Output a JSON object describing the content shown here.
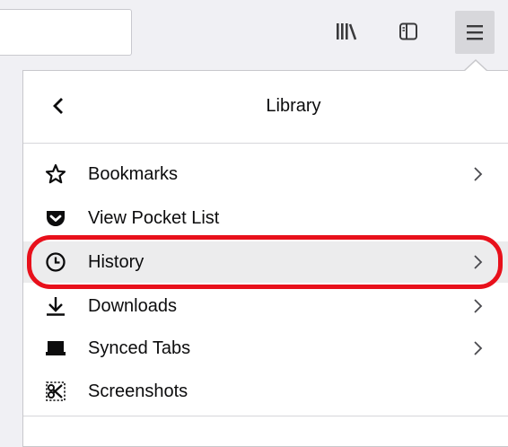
{
  "toolbar": {
    "library_icon": "library-icon",
    "sidebar_icon": "sidebar-icon",
    "menu_icon": "hamburger-menu-icon"
  },
  "panel": {
    "title": "Library",
    "back_icon": "back-chevron-icon",
    "items": [
      {
        "label": "Bookmarks",
        "icon": "star-icon",
        "has_submenu": true
      },
      {
        "label": "View Pocket List",
        "icon": "pocket-icon",
        "has_submenu": false
      },
      {
        "label": "History",
        "icon": "clock-icon",
        "has_submenu": true,
        "highlighted": true
      },
      {
        "label": "Downloads",
        "icon": "download-icon",
        "has_submenu": true
      },
      {
        "label": "Synced Tabs",
        "icon": "synced-tabs-icon",
        "has_submenu": true
      },
      {
        "label": "Screenshots",
        "icon": "screenshot-icon",
        "has_submenu": false
      }
    ]
  },
  "colors": {
    "annotation": "#e8101b",
    "panel_bg": "#ffffff",
    "toolbar_bg": "#f0f0f4"
  }
}
